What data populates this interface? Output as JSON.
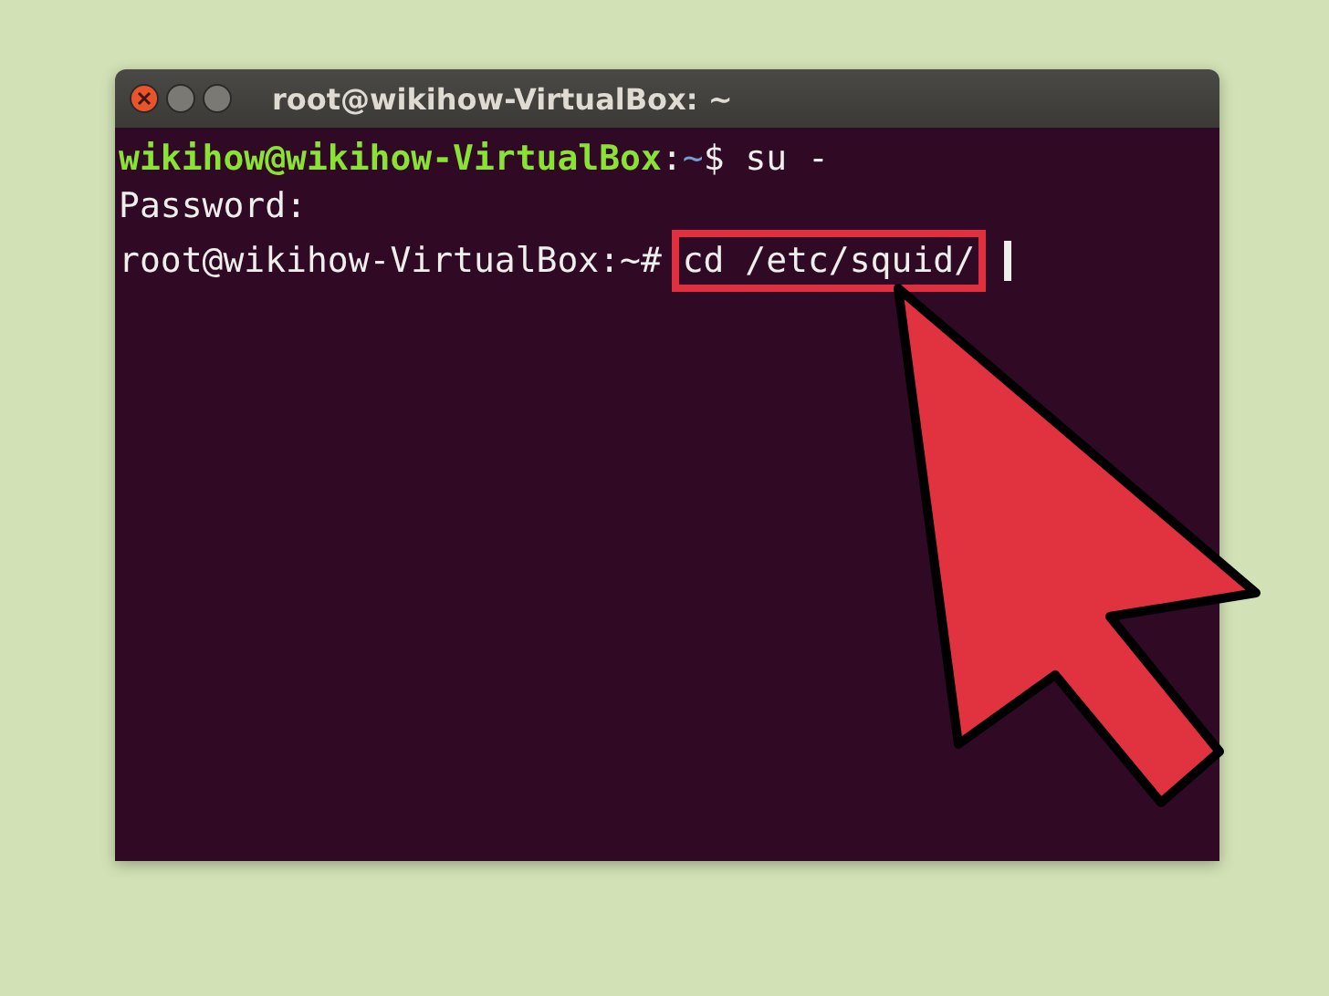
{
  "window": {
    "title": "root@wikihow-VirtualBox: ~"
  },
  "terminal": {
    "lines": [
      {
        "segments": [
          {
            "kind": "user",
            "text": "wikihow@wikihow-VirtualBox"
          },
          {
            "kind": "plain",
            "text": ":"
          },
          {
            "kind": "path",
            "text": "~"
          },
          {
            "kind": "plain",
            "text": "$ su -"
          }
        ]
      },
      {
        "segments": [
          {
            "kind": "plain",
            "text": "Password:"
          }
        ]
      },
      {
        "segments": [
          {
            "kind": "plain",
            "text": "root@wikihow-VirtualBox:~# "
          },
          {
            "kind": "highlight",
            "text": "cd /etc/squid/"
          }
        ],
        "cursor": true
      }
    ]
  }
}
